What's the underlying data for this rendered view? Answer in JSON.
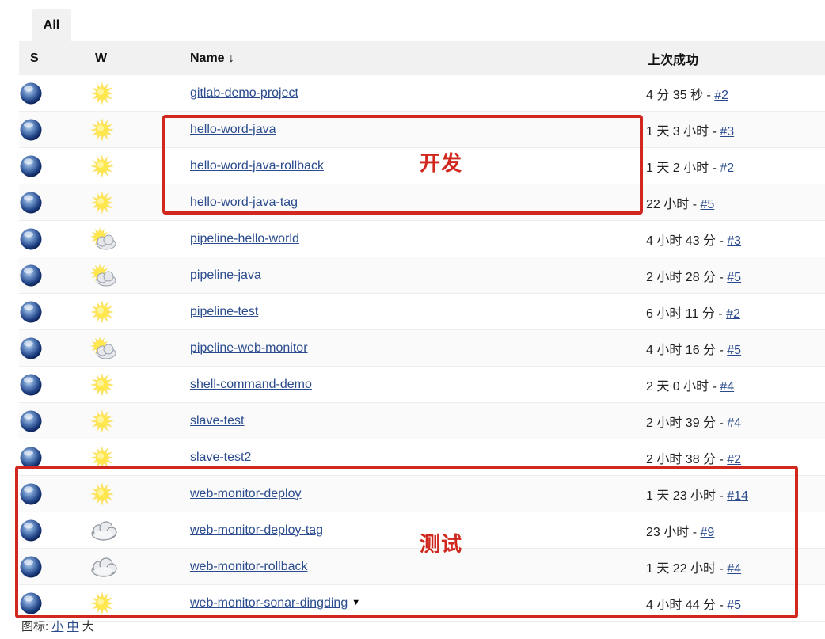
{
  "view_tab": {
    "label": "All"
  },
  "table": {
    "headers": {
      "status": "S",
      "weather": "W",
      "name": "Name",
      "sort_indicator": "↓",
      "last_success": "上次成功"
    },
    "rows": [
      {
        "name": "gitlab-demo-project",
        "weather": "sunny-icon",
        "last_success": "4 分 35 秒 - ",
        "build": "#2"
      },
      {
        "name": "hello-word-java",
        "weather": "sunny-icon",
        "last_success": "1 天 3 小时 - ",
        "build": "#3"
      },
      {
        "name": "hello-word-java-rollback",
        "weather": "sunny-icon",
        "last_success": "1 天 2 小时 - ",
        "build": "#2"
      },
      {
        "name": "hello-word-java-tag",
        "weather": "sunny-icon",
        "last_success": "22 小时 - ",
        "build": "#5"
      },
      {
        "name": "pipeline-hello-world",
        "weather": "partly-cloudy-icon",
        "last_success": "4 小时 43 分 - ",
        "build": "#3"
      },
      {
        "name": "pipeline-java",
        "weather": "partly-cloudy-icon",
        "last_success": "2 小时 28 分 - ",
        "build": "#5"
      },
      {
        "name": "pipeline-test",
        "weather": "sunny-icon",
        "last_success": "6 小时 11 分 - ",
        "build": "#2"
      },
      {
        "name": "pipeline-web-monitor",
        "weather": "partly-cloudy-icon",
        "last_success": "4 小时 16 分 - ",
        "build": "#5"
      },
      {
        "name": "shell-command-demo",
        "weather": "sunny-icon",
        "last_success": "2 天 0 小时 - ",
        "build": "#4"
      },
      {
        "name": "slave-test",
        "weather": "sunny-icon",
        "last_success": "2 小时 39 分 - ",
        "build": "#4"
      },
      {
        "name": "slave-test2",
        "weather": "sunny-icon",
        "last_success": "2 小时 38 分 - ",
        "build": "#2"
      },
      {
        "name": "web-monitor-deploy",
        "weather": "sunny-icon",
        "last_success": "1 天 23 小时 - ",
        "build": "#14"
      },
      {
        "name": "web-monitor-deploy-tag",
        "weather": "cloudy-icon",
        "last_success": "23 小时 - ",
        "build": "#9"
      },
      {
        "name": "web-monitor-rollback",
        "weather": "cloudy-icon",
        "last_success": "1 天 22 小时 - ",
        "build": "#4"
      },
      {
        "name": "web-monitor-sonar-dingding",
        "weather": "sunny-icon",
        "last_success": "4 小时 44 分 - ",
        "build": "#5",
        "has_menu": true
      }
    ]
  },
  "annotations": {
    "dev": "开发",
    "test": "测试"
  },
  "icon_legend": {
    "label": "图标: ",
    "small": "小",
    "medium": "中",
    "large": "大"
  },
  "colors": {
    "highlight": "#d0281e",
    "link": "#2a4b8d",
    "header_bg": "#f1f1f1"
  }
}
